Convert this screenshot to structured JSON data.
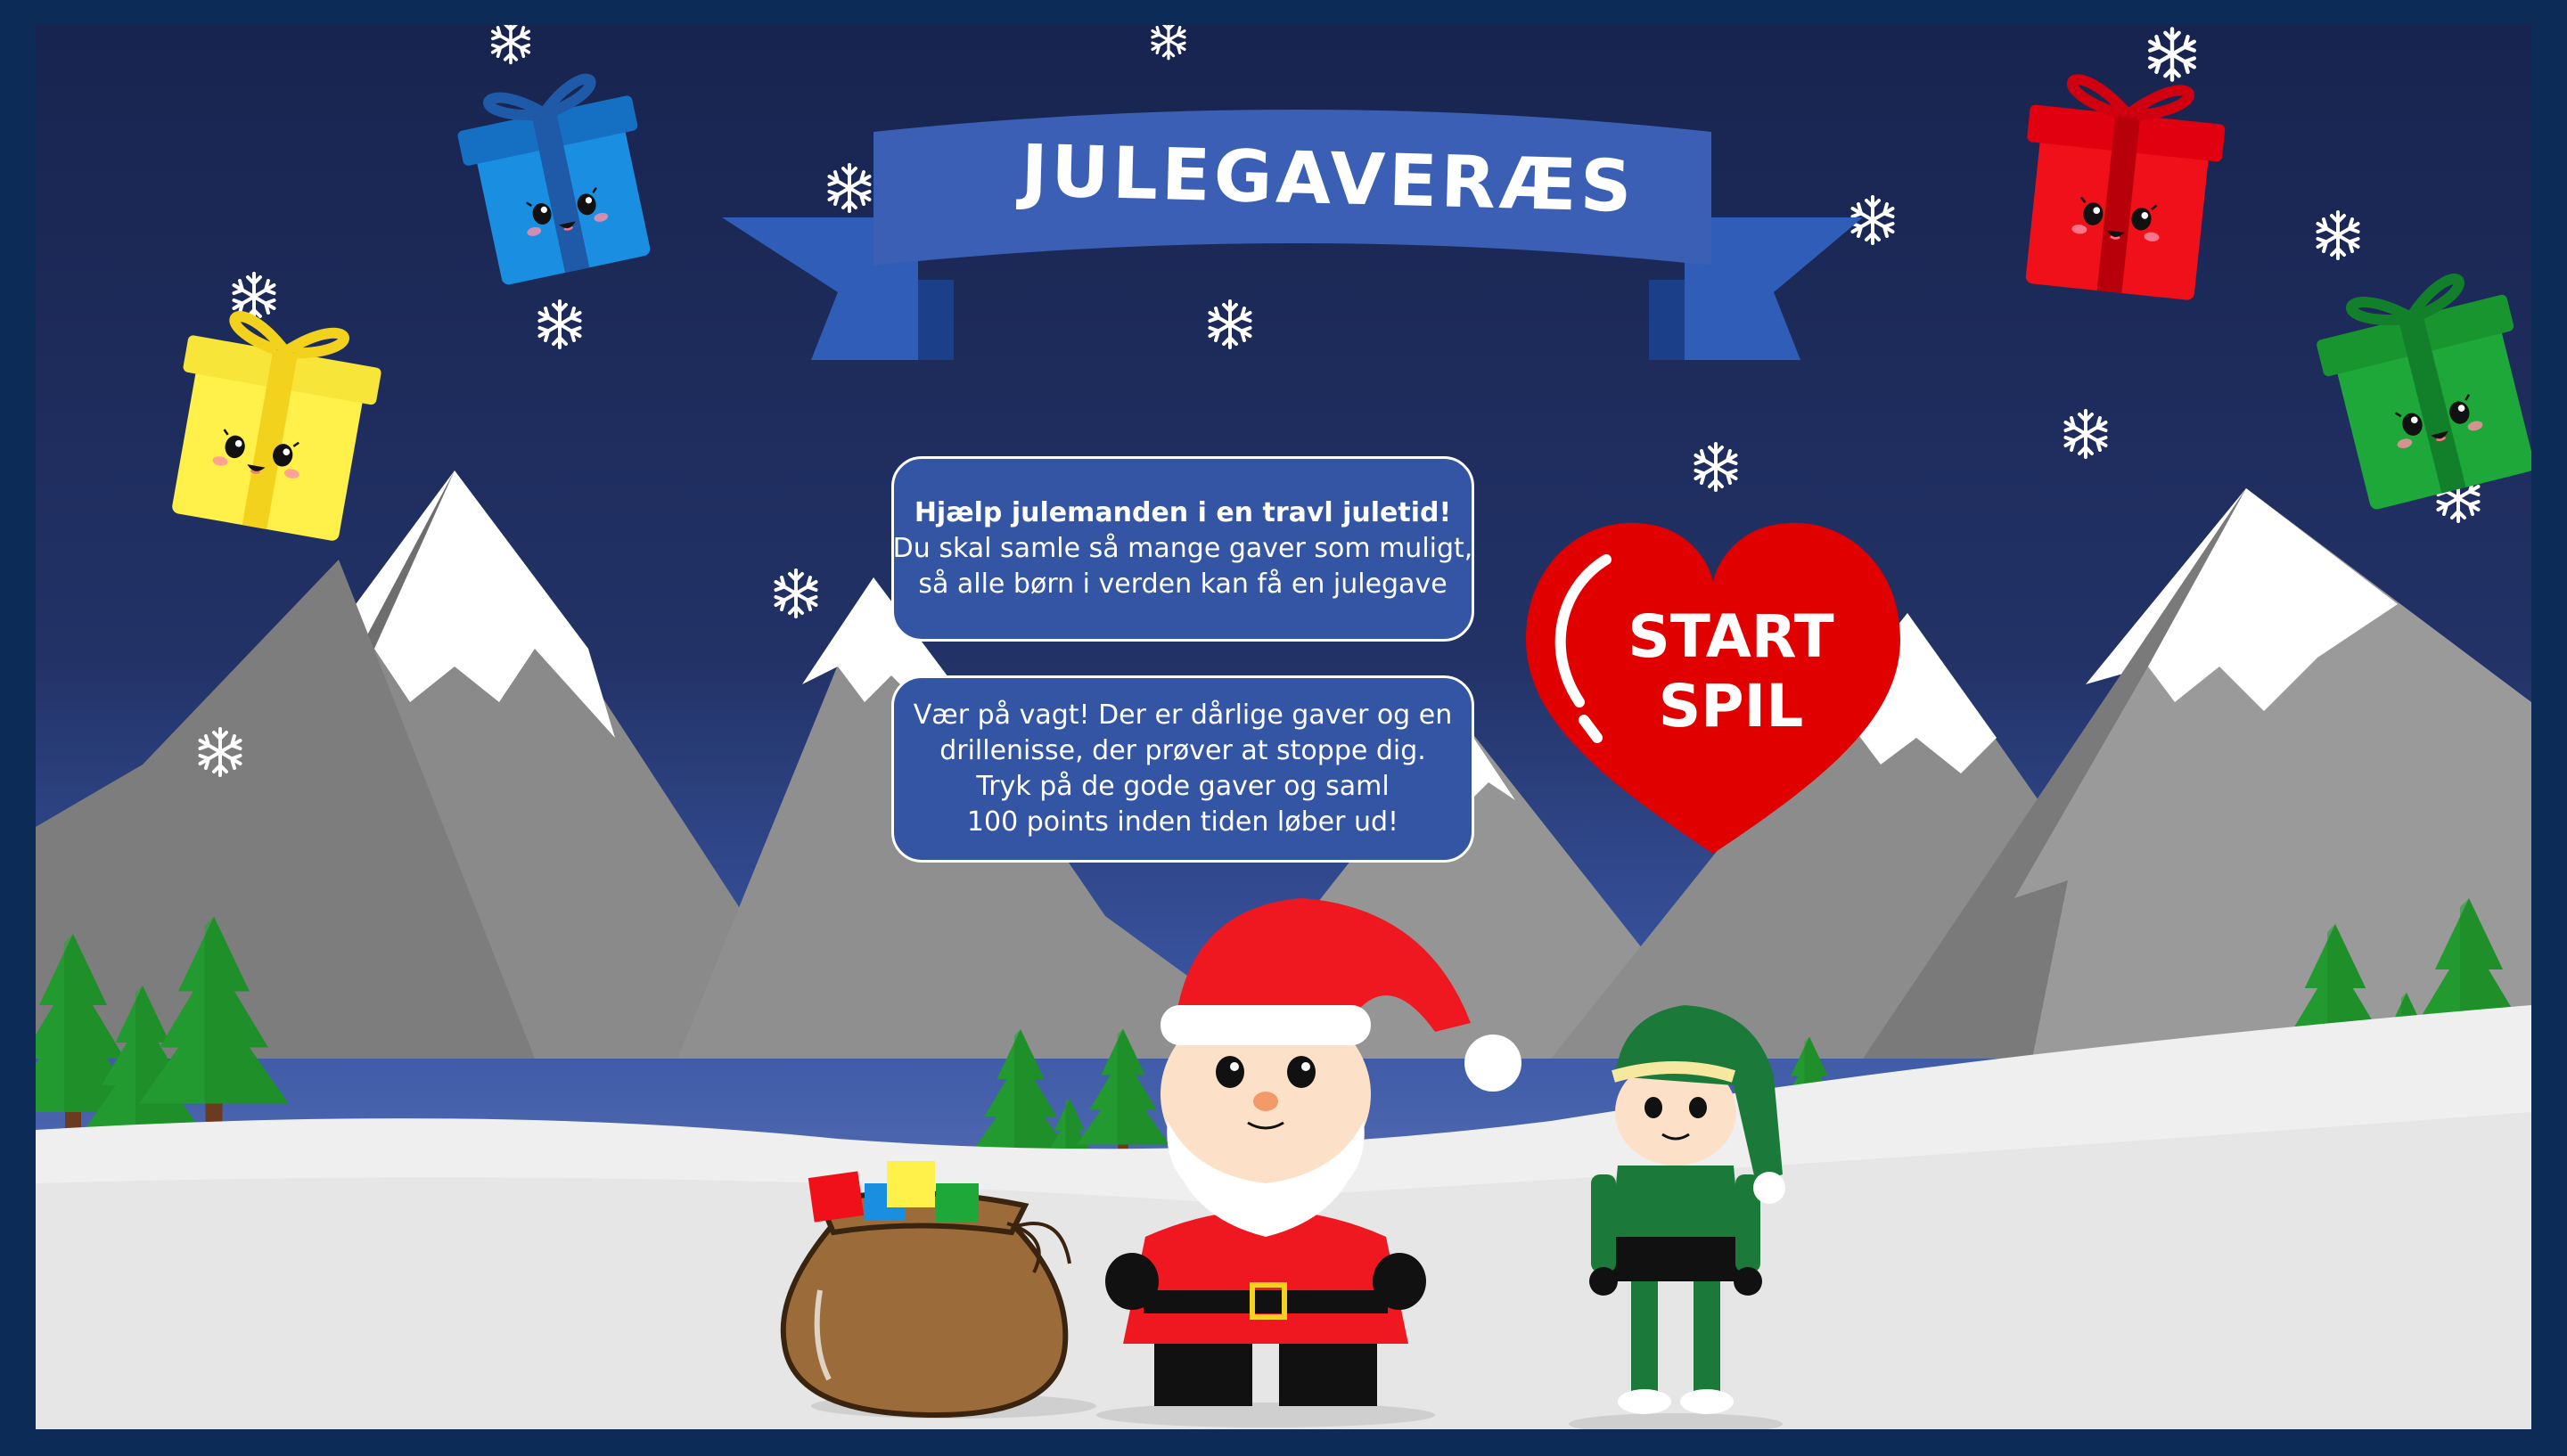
{
  "game": {
    "title": "JULEGAVERÆS",
    "intro_lines": [
      "Hjælp julemanden i en travl juletid!",
      "Du skal samle så mange gaver som muligt,",
      "så alle børn i verden kan få en julegave"
    ],
    "warning_lines": [
      "Vær på vagt! Der er dårlige gaver og en",
      "drillenisse, der prøver at stoppe dig.",
      "Tryk på de gode gaver og saml",
      "100 points inden tiden løber ud!"
    ],
    "start_button": {
      "line1": "START",
      "line2": "SPIL"
    }
  },
  "colors": {
    "sky_top": "#1a2657",
    "sky_bottom": "#4a65b0",
    "banner": "#3058a8",
    "heart": "#e00000",
    "snow": "#f2f2f2",
    "tree": "#1f8f2a",
    "gift_blue": "#1a8ee0",
    "gift_red": "#f0101a",
    "gift_yellow": "#fff04a",
    "gift_green": "#1ea83a"
  },
  "icons": {
    "snowflake": "snowflake-icon",
    "heart": "heart-icon",
    "gift": "gift-box-icon"
  }
}
